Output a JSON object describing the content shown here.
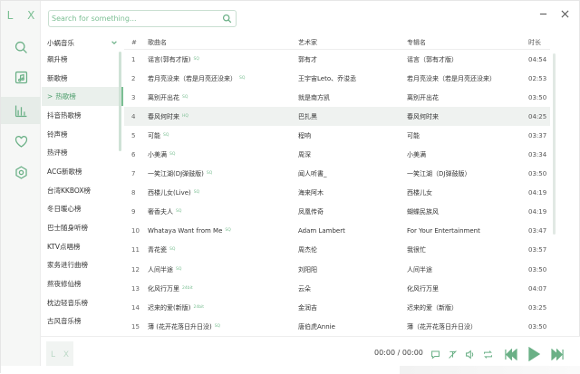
{
  "app": {
    "logo": "L X"
  },
  "search": {
    "placeholder": "Search for something..."
  },
  "sources": {
    "selected": "小蜗音乐",
    "items": [
      "飙升榜",
      "新歌榜",
      "热歌榜",
      "抖音热歌榜",
      "铃声榜",
      "热评榜",
      "ACG新歌榜",
      "台湾KKBOX榜",
      "冬日暖心榜",
      "巴士随身听榜",
      "KTV点唱榜",
      "家务进行曲榜",
      "熬夜修仙榜",
      "枕边轻音乐榜",
      "古风音乐榜"
    ],
    "active_index": 2,
    "active_prefix": ">"
  },
  "table": {
    "headers": {
      "no": "#",
      "name": "歌曲名",
      "artist": "艺术家",
      "album": "专辑名",
      "time": "时长"
    },
    "rows": [
      {
        "no": "1",
        "name": "谣言(郭有才版)",
        "quality": "SQ",
        "artist": "郭有才",
        "album": "谣言（郭有才版）",
        "time": "04:54"
      },
      {
        "no": "2",
        "name": "若月亮没来（若是月亮还没来）",
        "quality": "SQ",
        "artist": "王宇宙Leto、乔浚丞",
        "album": "若月亮没来（若是月亮还没来）",
        "time": "02:53"
      },
      {
        "no": "3",
        "name": "离别开出花",
        "quality": "SQ",
        "artist": "就是南方凯",
        "album": "离别开出花",
        "time": "03:50"
      },
      {
        "no": "4",
        "name": "春风何时来",
        "quality": "HQ",
        "artist": "巴扎黑",
        "album": "春风何时来",
        "time": "04:25"
      },
      {
        "no": "5",
        "name": "可能",
        "quality": "SQ",
        "artist": "程响",
        "album": "可能",
        "time": "03:37"
      },
      {
        "no": "6",
        "name": "小美满",
        "quality": "SQ",
        "artist": "周深",
        "album": "小美满",
        "time": "03:34"
      },
      {
        "no": "7",
        "name": "一笑江湖(DJ弹鼓版)",
        "quality": "SQ",
        "artist": "闻人听書_",
        "album": "一笑江湖（DJ弹鼓版）",
        "time": "03:50"
      },
      {
        "no": "8",
        "name": "西楼儿女(Live)",
        "quality": "SQ",
        "artist": "海来阿木",
        "album": "西楼儿女",
        "time": "04:19"
      },
      {
        "no": "9",
        "name": "奢香夫人",
        "quality": "SQ",
        "artist": "凤凰传奇",
        "album": "蝴蝶民族风",
        "time": "04:19"
      },
      {
        "no": "10",
        "name": "Whataya Want from Me",
        "quality": "SQ",
        "artist": "Adam Lambert",
        "album": "For Your Entertainment",
        "time": "03:47"
      },
      {
        "no": "11",
        "name": "青花瓷",
        "quality": "SQ",
        "artist": "周杰伦",
        "album": "我很忙",
        "time": "03:57"
      },
      {
        "no": "12",
        "name": "人间半途",
        "quality": "SQ",
        "artist": "刘阳阳",
        "album": "人间半途",
        "time": "03:50"
      },
      {
        "no": "13",
        "name": "化风行万里",
        "quality": "24bit",
        "artist": "云朵",
        "album": "化风行万里",
        "time": "04:07"
      },
      {
        "no": "14",
        "name": "迟来的爱(新版)",
        "quality": "24bit",
        "artist": "金润吉",
        "album": "迟来的爱（新版）",
        "time": "03:25"
      },
      {
        "no": "15",
        "name": "薄 (花开花落日升日没)",
        "quality": "SQ",
        "artist": "唐伯虎Annie",
        "album": "薄（花开花落日升日没）",
        "time": "03:50"
      }
    ],
    "highlight_index": 3
  },
  "player": {
    "cover_text": "L X",
    "time": "00:00 / 00:00"
  },
  "colors": {
    "accent": "#6ab086",
    "accent_light": "#7bbf93",
    "row_highlight": "#eff2f0"
  },
  "icons": {
    "rail": [
      "search-icon",
      "music-file-icon",
      "chart-icon",
      "heart-icon",
      "settings-icon"
    ],
    "player": [
      "comment-icon",
      "lyrics-off-icon",
      "volume-icon",
      "repeat-icon",
      "previous-icon",
      "play-icon",
      "next-icon"
    ]
  }
}
